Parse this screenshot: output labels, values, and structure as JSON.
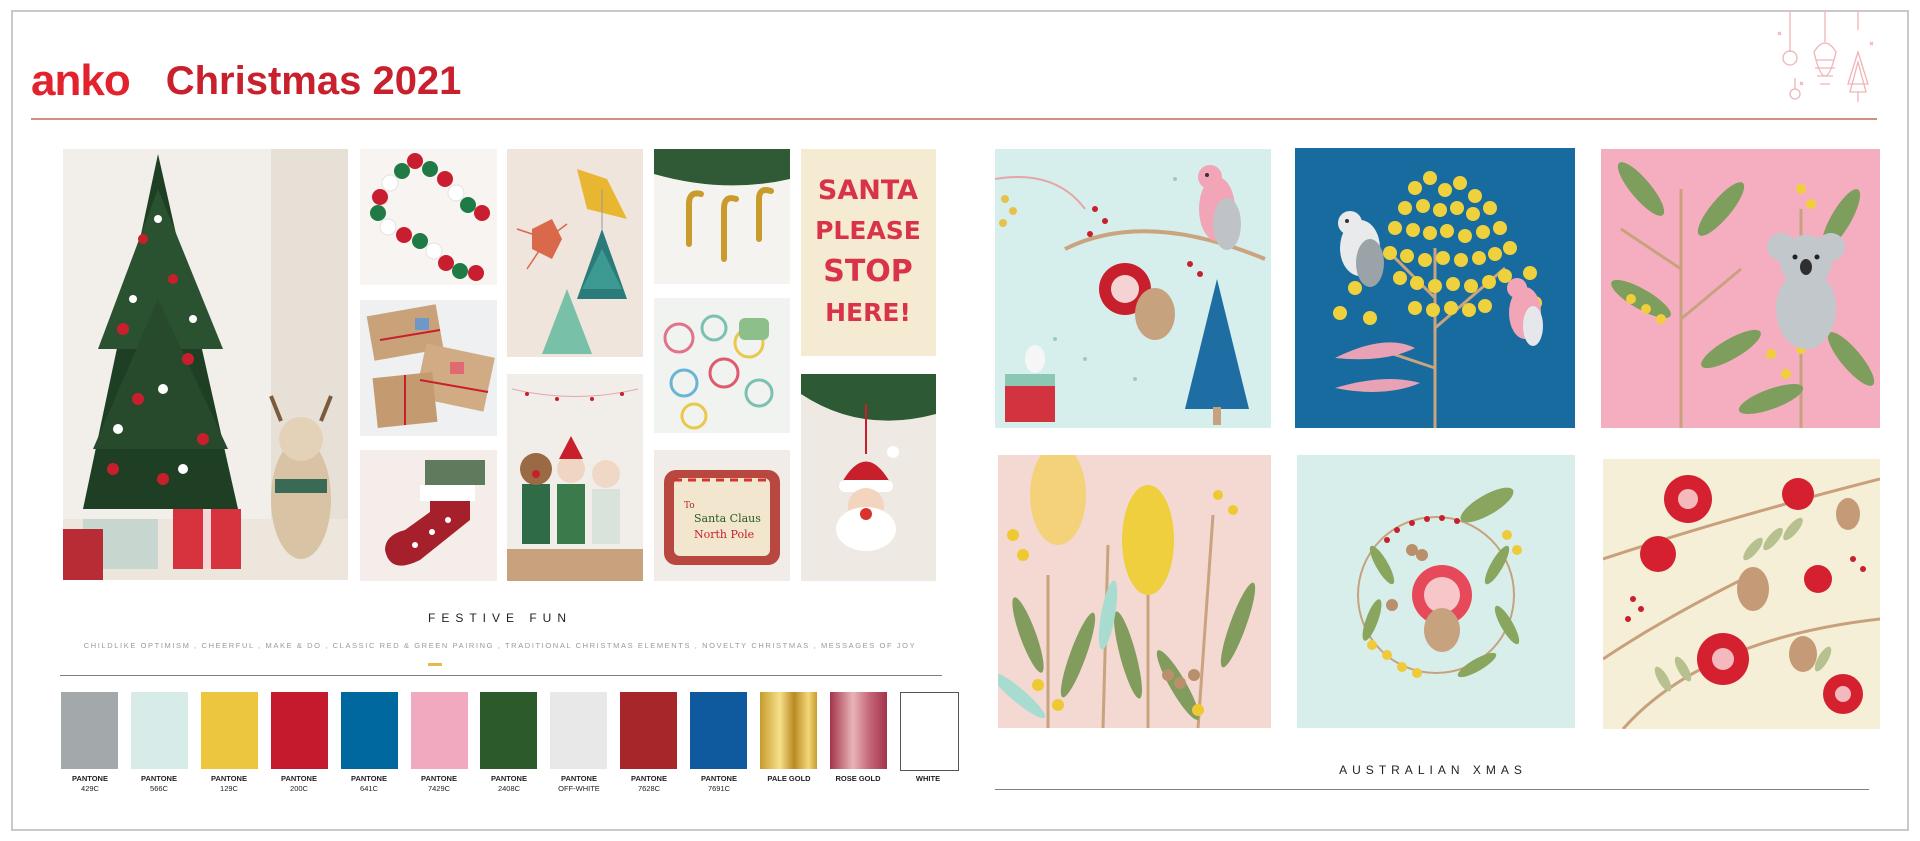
{
  "brand": {
    "logo": "anko",
    "title": "Christmas 2021"
  },
  "colors": {
    "brand_red": "#e2232e",
    "title_red": "#c8202c",
    "rule": "#d98a84"
  },
  "moodboard_left": {
    "caption": "FESTIVE FUN",
    "keywords": "CHILDLIKE OPTIMISM , CHEERFUL , MAKE & DO , CLASSIC RED & GREEN PAIRING , TRADITIONAL CHRISTMAS ELEMENTS , NOVELTY CHRISTMAS , MESSAGES OF JOY",
    "postcard": {
      "line1": "SANTA",
      "line2": "PLEASE",
      "line3": "STOP",
      "line4": "HERE!"
    },
    "pillow": {
      "to": "To",
      "name": "Santa Claus",
      "place": "North Pole"
    }
  },
  "palette": [
    {
      "line1": "PANTONE",
      "line2": "429C",
      "hex": "#a3a8ab"
    },
    {
      "line1": "PANTONE",
      "line2": "566C",
      "hex": "#d7ece8"
    },
    {
      "line1": "PANTONE",
      "line2": "129C",
      "hex": "#ecc63f"
    },
    {
      "line1": "PANTONE",
      "line2": "200C",
      "hex": "#c5192d"
    },
    {
      "line1": "PANTONE",
      "line2": "641C",
      "hex": "#00689e"
    },
    {
      "line1": "PANTONE",
      "line2": "7429C",
      "hex": "#f1a9bf"
    },
    {
      "line1": "PANTONE",
      "line2": "2408C",
      "hex": "#2d5a2a"
    },
    {
      "line1": "PANTONE",
      "line2": "OFF-WHITE",
      "hex": "#e8e8e8"
    },
    {
      "line1": "PANTONE",
      "line2": "7628C",
      "hex": "#a6262a"
    },
    {
      "line1": "PANTONE",
      "line2": "7691C",
      "hex": "#0f5a9e"
    },
    {
      "line1": "PALE GOLD",
      "line2": "",
      "hex": "gradient-gold"
    },
    {
      "line1": "ROSE GOLD",
      "line2": "",
      "hex": "gradient-rose"
    },
    {
      "line1": "WHITE",
      "line2": "",
      "hex": "#ffffff"
    }
  ],
  "moodboard_right": {
    "caption": "AUSTRALIAN XMAS"
  }
}
